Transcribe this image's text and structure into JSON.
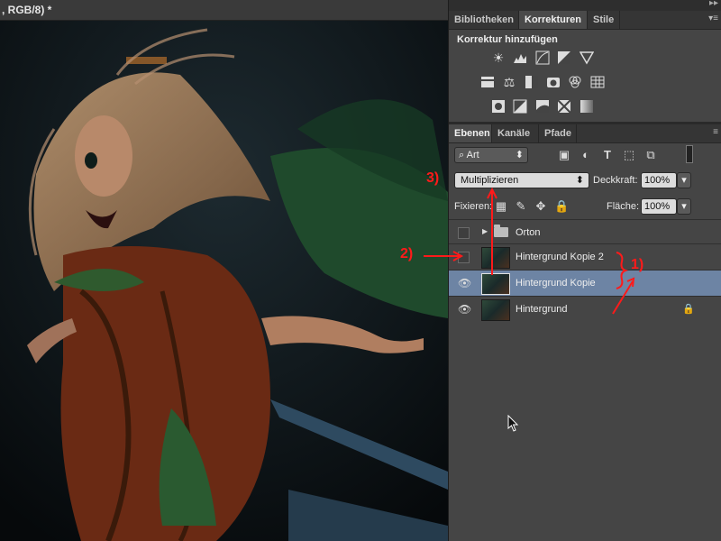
{
  "document": {
    "tab_title": ", RGB/8) *"
  },
  "panel_top": {
    "collapse": "▸▸"
  },
  "tabs_top": [
    {
      "label": "Bibliotheken",
      "active": false
    },
    {
      "label": "Korrekturen",
      "active": true
    },
    {
      "label": "Stile",
      "active": false
    }
  ],
  "korrekturen": {
    "title": "Korrektur hinzufügen"
  },
  "tabs_layers": [
    {
      "label": "Ebenen",
      "active": true
    },
    {
      "label": "Kanäle",
      "active": false
    },
    {
      "label": "Pfade",
      "active": false
    }
  ],
  "filter": {
    "kind": "Art"
  },
  "blend": {
    "mode": "Multiplizieren",
    "opacity_label": "Deckkraft:",
    "opacity_value": "100%"
  },
  "lock": {
    "label": "Fixieren:",
    "fill_label": "Fläche:",
    "fill_value": "100%"
  },
  "layers": [
    {
      "name": "Orton",
      "type": "group",
      "visible": false,
      "selected": false
    },
    {
      "name": "Hintergrund Kopie 2",
      "type": "image",
      "visible": false,
      "selected": false
    },
    {
      "name": "Hintergrund Kopie",
      "type": "image",
      "visible": true,
      "selected": true
    },
    {
      "name": "Hintergrund",
      "type": "image",
      "visible": true,
      "selected": false,
      "locked": true
    }
  ],
  "annotations": {
    "a1": "1)",
    "a2": "2)",
    "a3": "3)",
    "accent": "#ff1a1a"
  },
  "colors": {
    "selection": "#6d84a4",
    "panel": "#454545"
  }
}
